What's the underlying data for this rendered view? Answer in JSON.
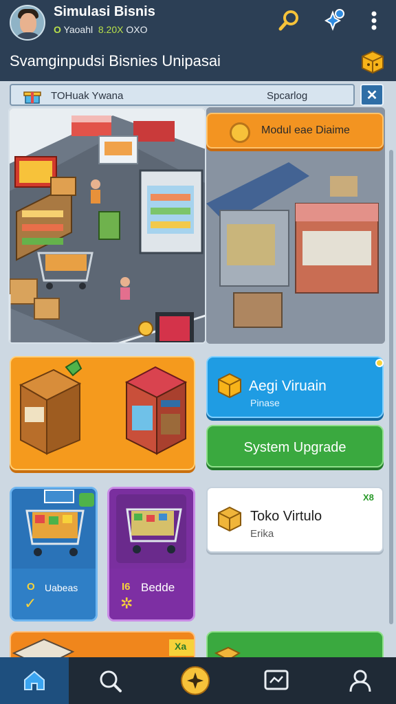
{
  "header": {
    "app_title": "Simulasi Bisnis",
    "stats_prefix": "O",
    "stats_label": "Yaoahl",
    "stats_percent": "8.20X",
    "stats_suffix": "OXO",
    "subtitle": "Svamginpudsi Bisnies Unipasai"
  },
  "search": {
    "value": "TOHuak Ywana",
    "placeholder": "Spcarlog",
    "close_label": "✕"
  },
  "modul_button": {
    "label": "Modul eae Diaime"
  },
  "blue_card": {
    "title": "Aegi Viruain",
    "subtitle": "Pinase"
  },
  "upgrade_button": {
    "label": "System Upgrade"
  },
  "cart_cards": [
    {
      "prefix": "O",
      "label": "Uabeas"
    },
    {
      "prefix": "I6",
      "label": "Bedde"
    }
  ],
  "toko_card": {
    "title": "Toko Virtulo",
    "subtitle": "Erika",
    "badge": "X8"
  },
  "bottom_badge": "Xa",
  "tabs": [
    {
      "name": "home",
      "icon": "home-icon"
    },
    {
      "name": "search",
      "icon": "search-icon"
    },
    {
      "name": "star",
      "icon": "star-coin-icon"
    },
    {
      "name": "stats",
      "icon": "screen-icon"
    },
    {
      "name": "profile",
      "icon": "user-icon"
    }
  ],
  "colors": {
    "header_bg": "#2c3f55",
    "accent_orange": "#f39421",
    "accent_blue": "#1f9ce3",
    "accent_green": "#3aa93f",
    "tab_active": "#1e4f7e"
  }
}
